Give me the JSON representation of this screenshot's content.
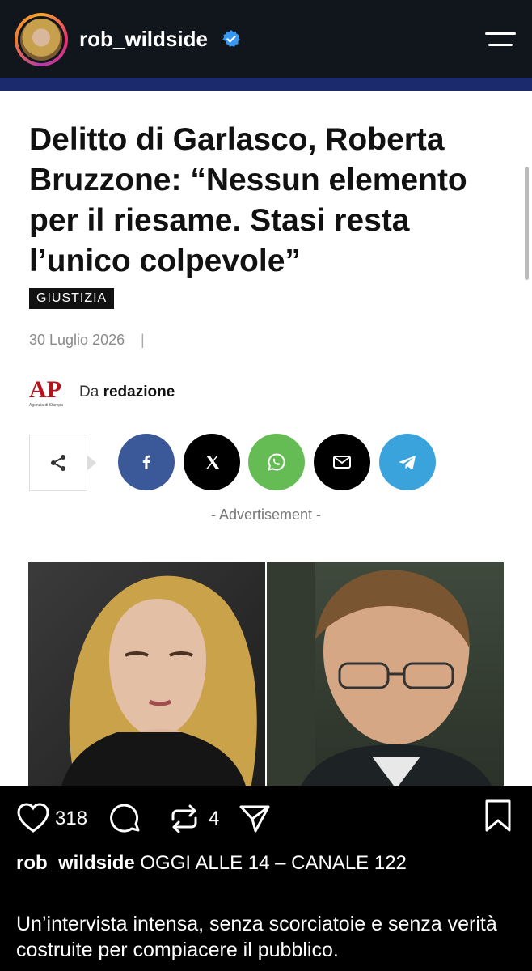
{
  "header": {
    "username": "rob_wildside"
  },
  "article": {
    "headline": "Delitto di Garlasco, Roberta Bruzzone: “Nessun elemento per il riesame. Stasi resta l’unico colpevole”",
    "category": "GIUSTIZIA",
    "date": "30 Luglio 2026",
    "date_separator": "|",
    "publisher_logo": "AP",
    "publisher_logo_sub": "Agenzia di Stampa",
    "byline_prefix": "Da",
    "byline_author": "redazione",
    "advertisement_label": "- Advertisement -",
    "share_buttons": [
      {
        "name": "facebook",
        "color": "#3b5998"
      },
      {
        "name": "x",
        "color": "#000000"
      },
      {
        "name": "whatsapp",
        "color": "#65bc54"
      },
      {
        "name": "email",
        "color": "#000000"
      },
      {
        "name": "telegram",
        "color": "#3aa3dc"
      }
    ]
  },
  "post": {
    "likes": "318",
    "reposts": "4",
    "caption_user": "rob_wildside",
    "caption_text": "OGGI ALLE 14 – CANALE 122",
    "body": "Un’intervista intensa, senza scorciatoie e senza verità costruite per compiacere il pubblico."
  },
  "colors": {
    "nav_strip": "#1a2a6c",
    "verified": "#3897f0"
  }
}
